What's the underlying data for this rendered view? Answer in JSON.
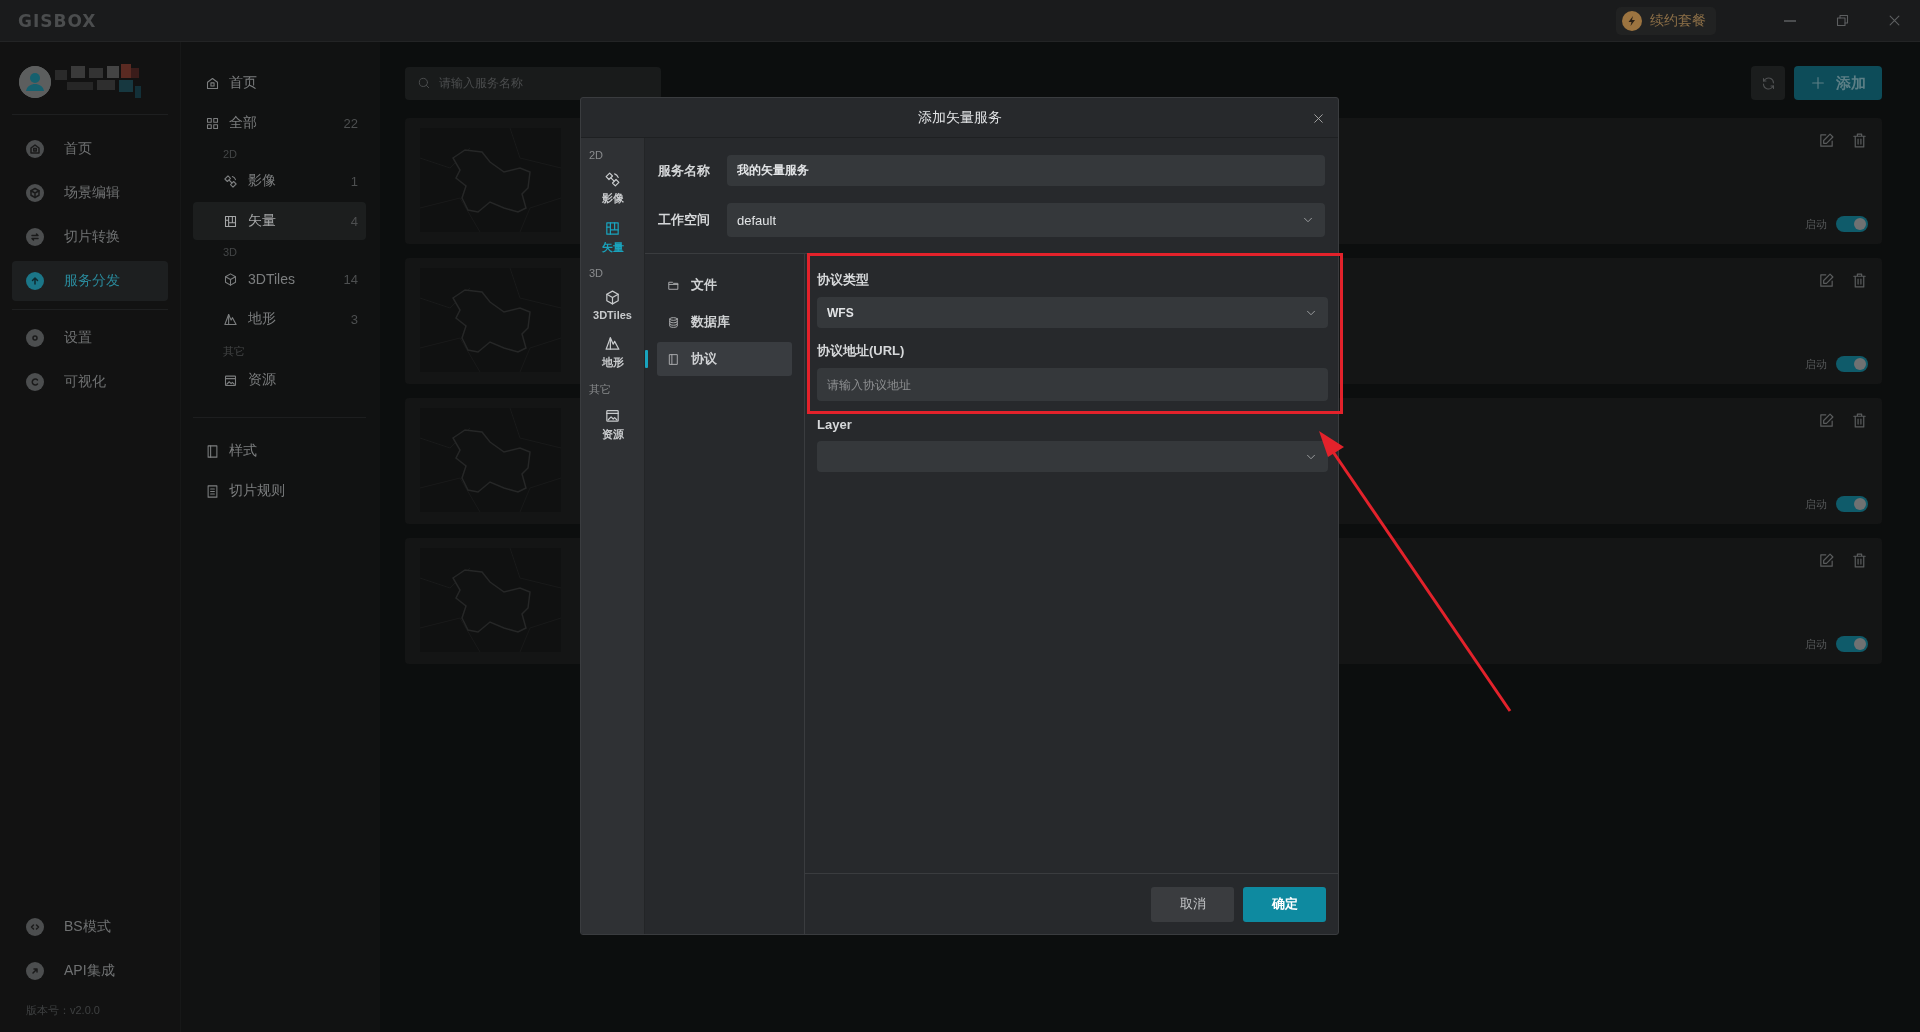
{
  "titlebar": {
    "logo": "GISBOX",
    "renew_button": "续约套餐"
  },
  "nav": {
    "items": [
      {
        "label": "首页",
        "selected": false
      },
      {
        "label": "场景编辑",
        "selected": false
      },
      {
        "label": "切片转换",
        "selected": false
      },
      {
        "label": "服务分发",
        "selected": true
      },
      {
        "label": "设置",
        "selected": false
      },
      {
        "label": "可视化",
        "selected": false
      }
    ],
    "bottom_items": [
      {
        "label": "BS模式"
      },
      {
        "label": "API集成"
      }
    ],
    "version": "版本号：v2.0.0"
  },
  "categories": {
    "items": [
      {
        "kind": "item",
        "label": "首页",
        "selected": false
      },
      {
        "kind": "item",
        "label": "全部",
        "count": "22",
        "selected": false
      },
      {
        "kind": "heading",
        "label": "2D"
      },
      {
        "kind": "sub",
        "label": "影像",
        "count": "1",
        "selected": false
      },
      {
        "kind": "sub",
        "label": "矢量",
        "count": "4",
        "selected": true
      },
      {
        "kind": "heading",
        "label": "3D"
      },
      {
        "kind": "sub",
        "label": "3DTiles",
        "count": "14",
        "selected": false
      },
      {
        "kind": "sub",
        "label": "地形",
        "count": "3",
        "selected": false
      },
      {
        "kind": "heading",
        "label": "其它"
      },
      {
        "kind": "sub",
        "label": "资源",
        "selected": false
      },
      {
        "kind": "divider"
      },
      {
        "kind": "item",
        "label": "样式",
        "selected": false
      },
      {
        "kind": "item",
        "label": "切片规则",
        "selected": false
      }
    ]
  },
  "search": {
    "placeholder": "请输入服务名称"
  },
  "toolbar": {
    "add_button": "添加"
  },
  "cards": [
    {
      "status_label": "启动",
      "on": true
    },
    {
      "status_label": "启动",
      "on": true
    },
    {
      "status_label": "启动",
      "on": true
    },
    {
      "status_label": "启动",
      "on": true
    }
  ],
  "dialog": {
    "title": "添加矢量服务",
    "rail": [
      {
        "kind": "heading",
        "label": "2D"
      },
      {
        "kind": "item",
        "label": "影像",
        "selected": false
      },
      {
        "kind": "item",
        "label": "矢量",
        "selected": true
      },
      {
        "kind": "heading",
        "label": "3D"
      },
      {
        "kind": "item",
        "label": "3DTiles",
        "selected": false
      },
      {
        "kind": "item",
        "label": "地形",
        "selected": false
      },
      {
        "kind": "heading",
        "label": "其它"
      },
      {
        "kind": "item",
        "label": "资源",
        "selected": false
      }
    ],
    "fields": [
      {
        "kind": "input",
        "label": "服务名称",
        "value": "我的矢量服务"
      },
      {
        "kind": "select",
        "label": "工作空间",
        "value": "default"
      }
    ],
    "sources": [
      {
        "label": "文件",
        "selected": false
      },
      {
        "label": "数据库",
        "selected": false
      },
      {
        "label": "协议",
        "selected": true
      }
    ],
    "protocol_type": {
      "label": "协议类型",
      "value": "WFS"
    },
    "url": {
      "label": "协议地址(URL)",
      "placeholder": "请输入协议地址"
    },
    "layer": {
      "label": "Layer"
    },
    "buttons": {
      "cancel": "取消",
      "ok": "确定"
    }
  }
}
